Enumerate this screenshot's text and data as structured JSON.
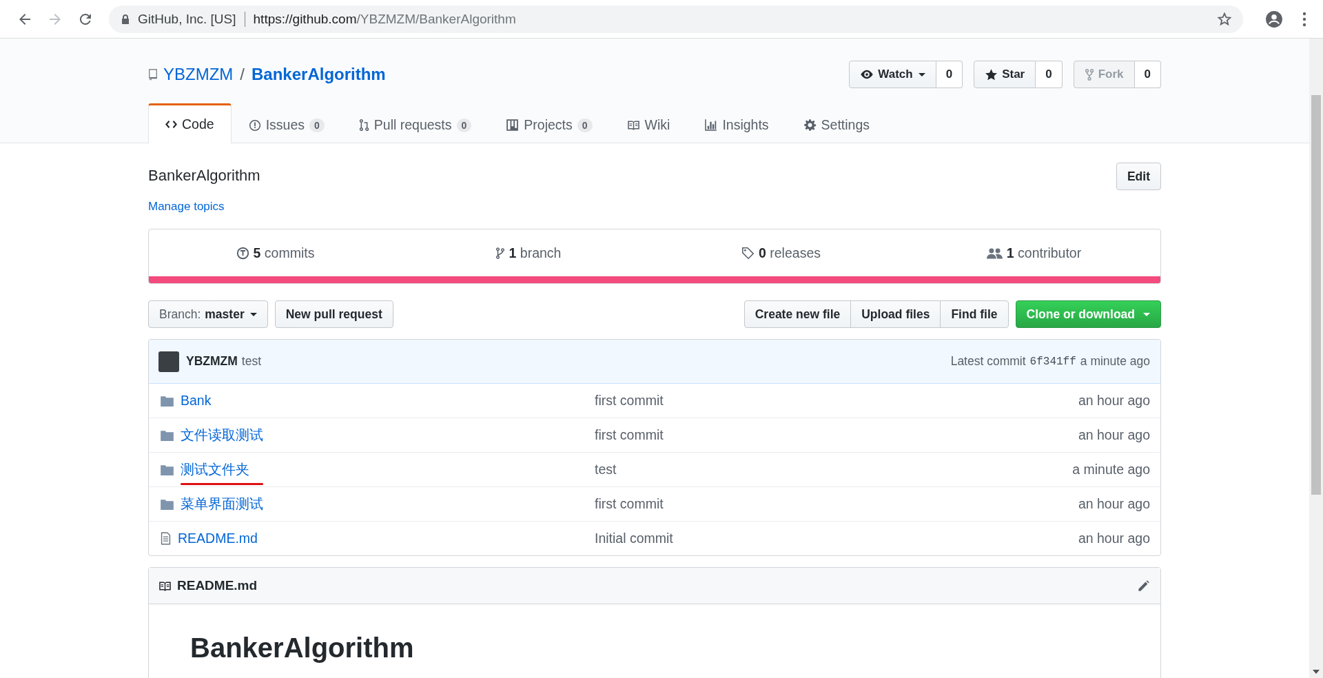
{
  "browser": {
    "site_identity": "GitHub, Inc. [US]",
    "url_host": "https://github.com",
    "url_path": "/YBZMZM/BankerAlgorithm"
  },
  "repo": {
    "owner": "YBZMZM",
    "separator": "/",
    "name": "BankerAlgorithm"
  },
  "actions": [
    {
      "kind": "watch",
      "label": "Watch",
      "count": "0",
      "disabled": false
    },
    {
      "kind": "star",
      "label": "Star",
      "count": "0",
      "disabled": false
    },
    {
      "kind": "fork",
      "label": "Fork",
      "count": "0",
      "disabled": true
    }
  ],
  "tabs": [
    {
      "kind": "code",
      "label": "Code",
      "selected": true
    },
    {
      "kind": "issues",
      "label": "Issues",
      "count": "0",
      "selected": false
    },
    {
      "kind": "pulls",
      "label": "Pull requests",
      "count": "0",
      "selected": false
    },
    {
      "kind": "projects",
      "label": "Projects",
      "count": "0",
      "selected": false
    },
    {
      "kind": "wiki",
      "label": "Wiki",
      "selected": false
    },
    {
      "kind": "insights",
      "label": "Insights",
      "selected": false
    },
    {
      "kind": "settings",
      "label": "Settings",
      "selected": false
    }
  ],
  "description": "BankerAlgorithm",
  "manage_topics": "Manage topics",
  "edit_button": "Edit",
  "stats": [
    {
      "kind": "commits",
      "count": "5",
      "label": "commits"
    },
    {
      "kind": "branch",
      "count": "1",
      "label": "branch"
    },
    {
      "kind": "releases",
      "count": "0",
      "label": "releases"
    },
    {
      "kind": "contributors",
      "count": "1",
      "label": "contributor"
    }
  ],
  "language_bar": {
    "color": "#f34b7d"
  },
  "branch_button": {
    "prefix": "Branch:",
    "value": "master"
  },
  "new_pull_request": "New pull request",
  "file_buttons": [
    "Create new file",
    "Upload files",
    "Find file"
  ],
  "clone_button": "Clone or download",
  "commit": {
    "author": "YBZMZM",
    "message": "test",
    "latest_label": "Latest commit",
    "sha": "6f341ff",
    "time": "a minute ago"
  },
  "files": [
    {
      "kind": "folder",
      "name": "Bank",
      "message": "first commit",
      "age": "an hour ago",
      "underlined": false
    },
    {
      "kind": "folder",
      "name": "文件读取测试",
      "message": "first commit",
      "age": "an hour ago",
      "underlined": false
    },
    {
      "kind": "folder",
      "name": "测试文件夹",
      "message": "test",
      "age": "a minute ago",
      "underlined": true
    },
    {
      "kind": "folder",
      "name": "菜单界面测试",
      "message": "first commit",
      "age": "an hour ago",
      "underlined": false
    },
    {
      "kind": "file",
      "name": "README.md",
      "message": "Initial commit",
      "age": "an hour ago",
      "underlined": false
    }
  ],
  "readme": {
    "title": "README.md",
    "heading": "BankerAlgorithm"
  }
}
